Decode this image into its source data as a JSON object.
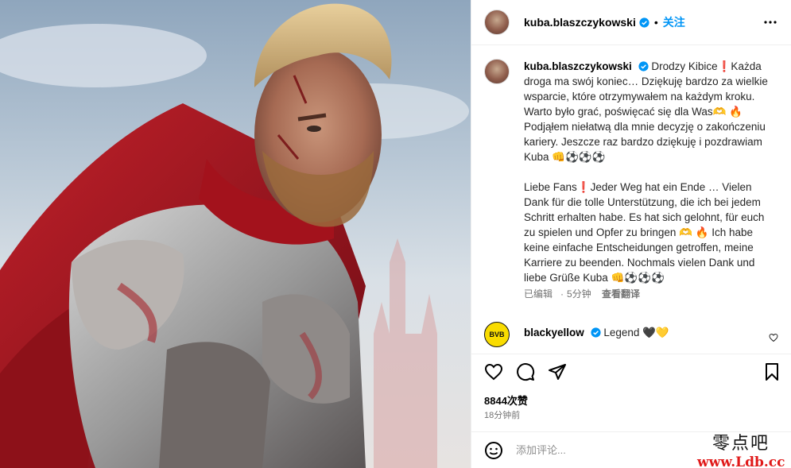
{
  "post": {
    "username": "kuba.blaszczykowski",
    "follow_label": "关注",
    "separator": "•"
  },
  "caption": {
    "username": "kuba.blaszczykowski",
    "polish": "Drodzy Kibice❗Każda droga ma swój koniec… Dziękuję bardzo za wielkie wsparcie, które otrzymywałem na każdym kroku. Warto było grać, poświęcać się dla Was🫶 🔥Podjąłem niełatwą dla mnie decyzję o zakończeniu kariery. Jeszcze raz bardzo dziękuję i pozdrawiam Kuba 👊⚽⚽⚽",
    "german": "Liebe Fans❗Jeder Weg hat ein Ende … Vielen Dank für die tolle Unterstützung, die ich bei jedem Schritt erhalten habe. Es hat sich gelohnt, für euch zu spielen und Opfer zu bringen 🫶 🔥 Ich habe keine einfache Entscheidungen getroffen, meine Karriere zu beenden. Nochmals vielen Dank und liebe Grüße Kuba 👊⚽⚽⚽",
    "edited": "已编辑",
    "dot": "·",
    "age": "5分钟",
    "translate": "查看翻译"
  },
  "comment": {
    "username": "blackyellow",
    "text": "Legend 🖤💛",
    "avatar_text": "BVB"
  },
  "stats": {
    "likes": "8844次赞",
    "time_ago": "18分钟前"
  },
  "input": {
    "placeholder": "添加评论..."
  },
  "watermark": {
    "line1": "零点吧",
    "line2": "www.Ldb.cc"
  },
  "colors": {
    "accent": "#0095f6",
    "verified": "#0095f6",
    "bvb_yellow": "#f9dc00"
  },
  "icons": [
    "more-icon",
    "verified-icon",
    "heart-icon",
    "comment-icon",
    "share-icon",
    "bookmark-icon",
    "emoji-icon",
    "heart-small-icon"
  ]
}
